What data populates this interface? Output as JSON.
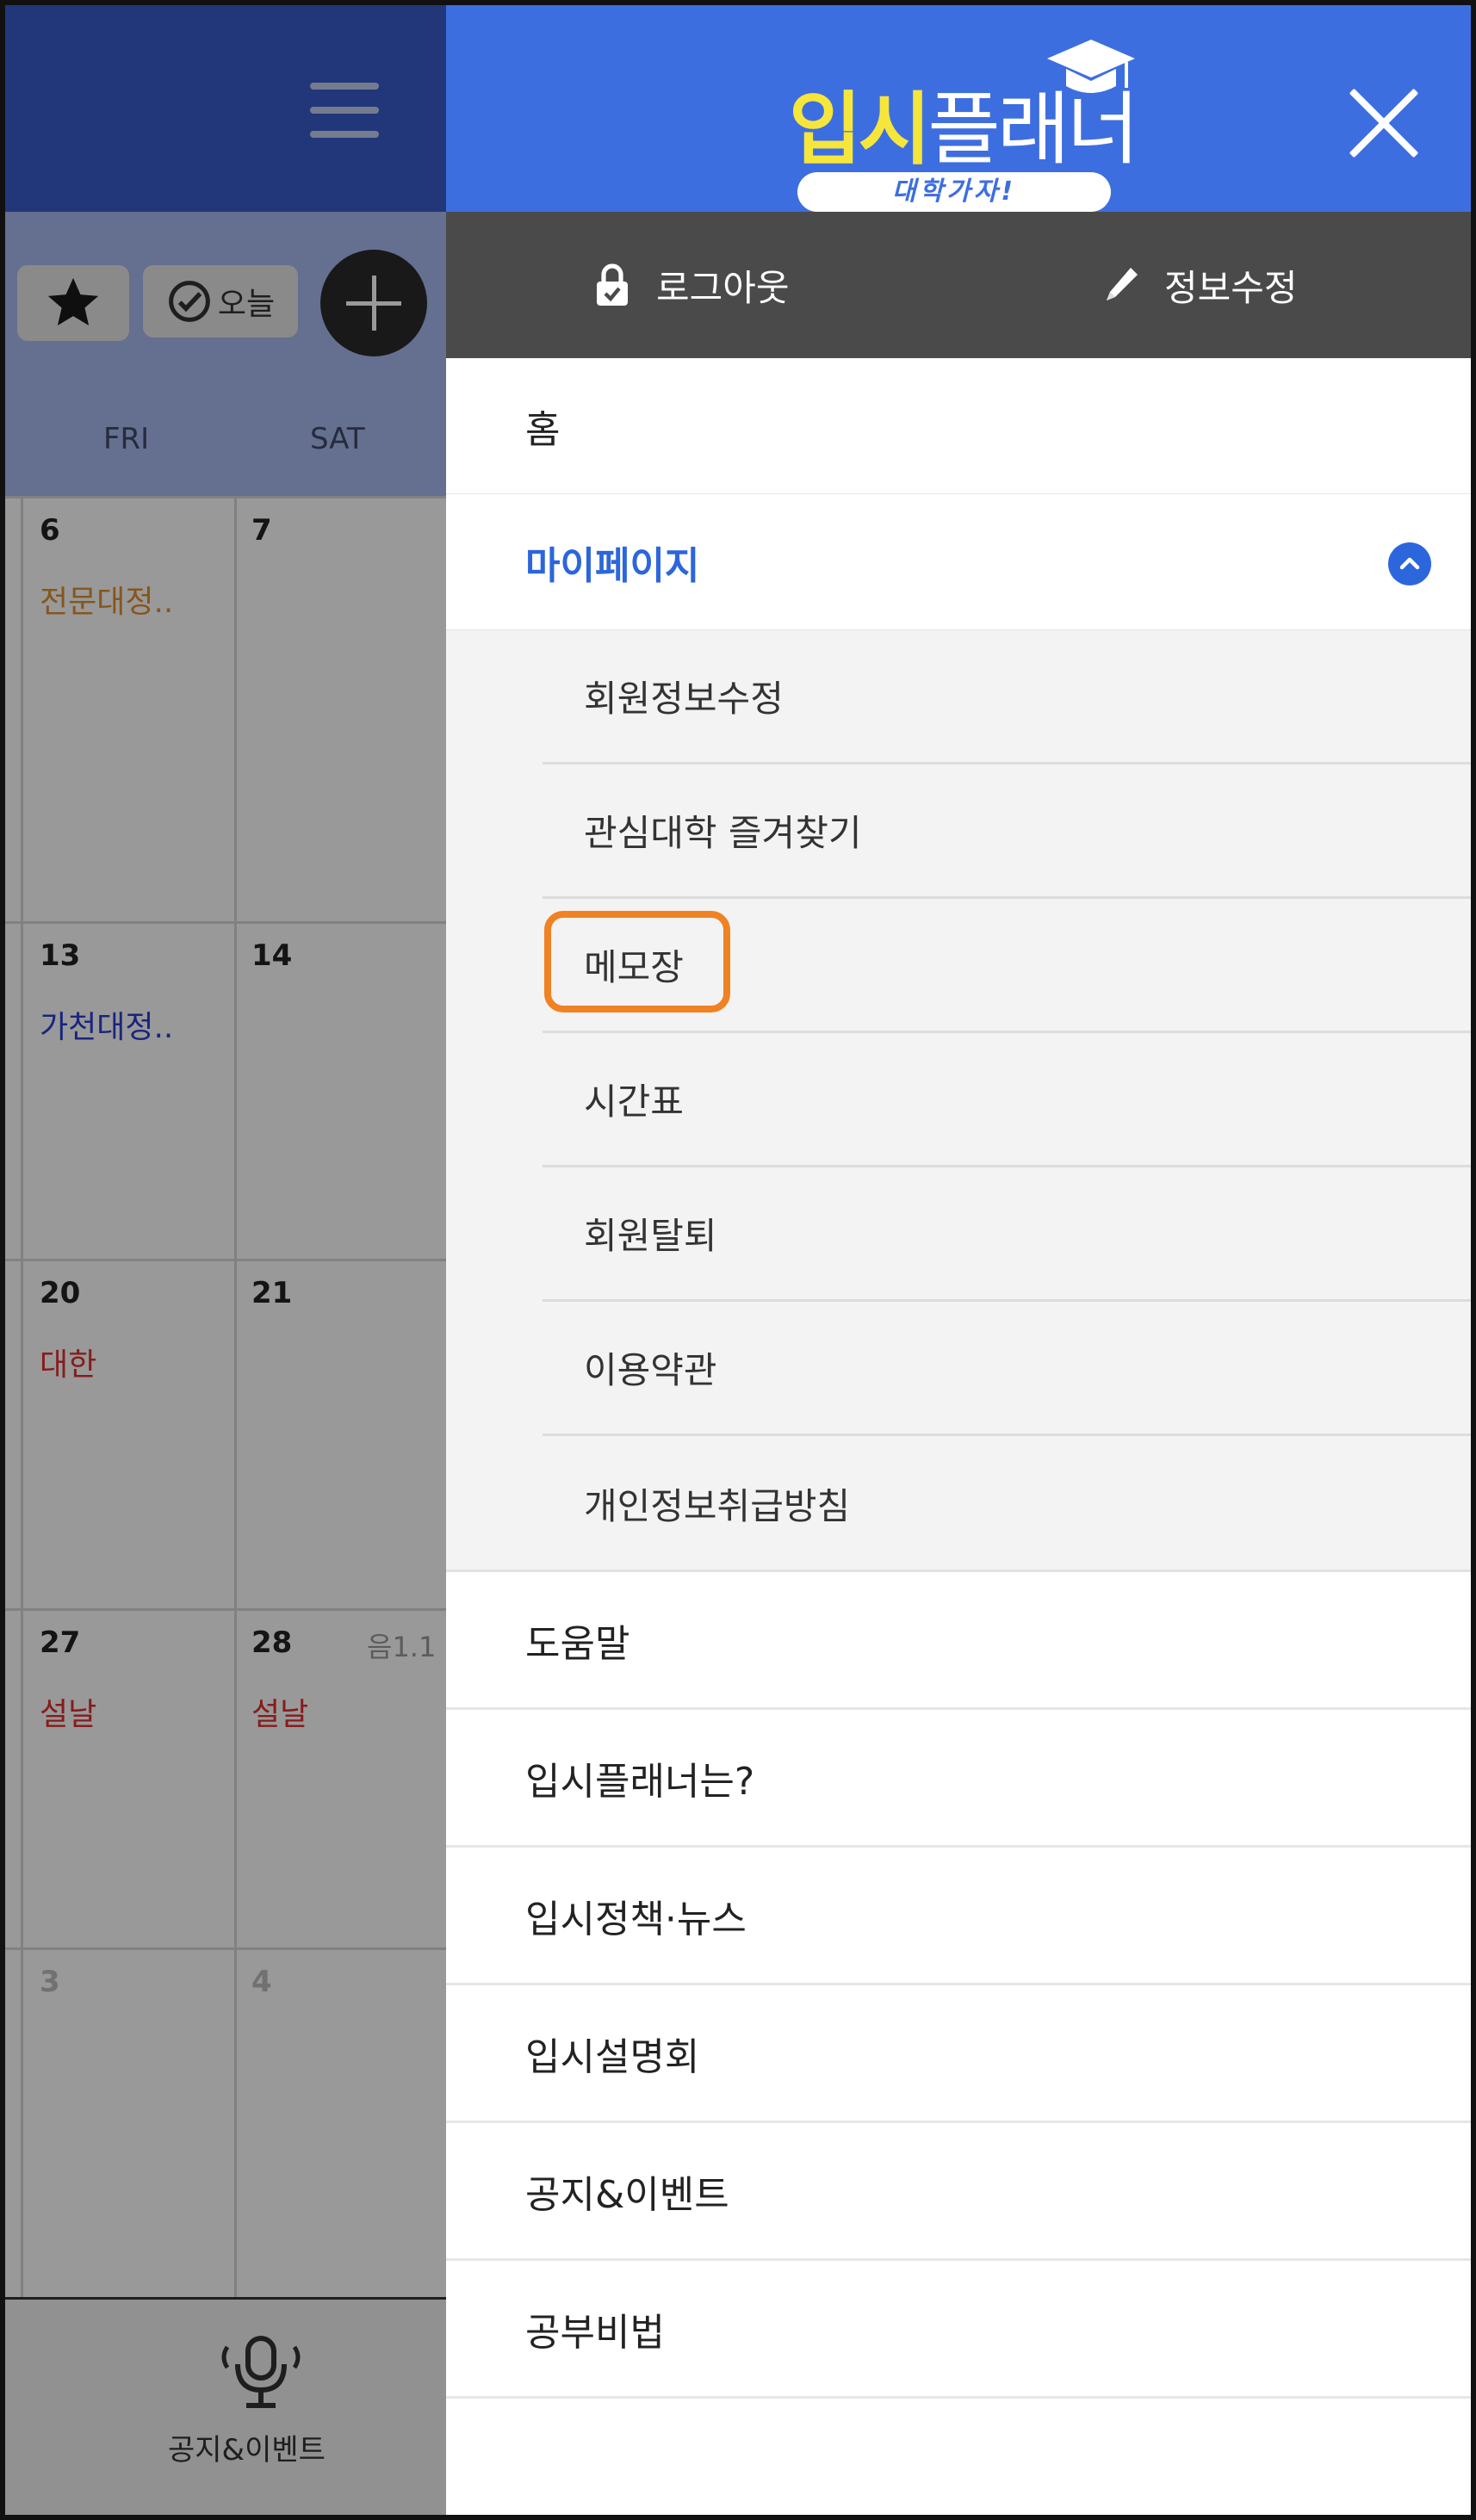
{
  "calendar": {
    "today_label": "오늘",
    "weekdays": [
      "FRI",
      "SAT"
    ],
    "rows": [
      {
        "days": [
          "6",
          "7"
        ],
        "events": [
          {
            "text": "전문대정..",
            "color": "#e09030"
          }
        ]
      },
      {
        "days": [
          "13",
          "14"
        ],
        "events": [
          {
            "text": "가천대정..",
            "color": "#2a3fd0"
          }
        ]
      },
      {
        "days": [
          "20",
          "21"
        ],
        "events": [
          {
            "text": "대한",
            "color": "#e03030"
          }
        ]
      },
      {
        "days": [
          "27",
          "28"
        ],
        "lunar": "음1.1",
        "events": [
          {
            "text": "설날",
            "color": "#e03030"
          },
          {
            "text": "설날",
            "color": "#e03030"
          }
        ]
      },
      {
        "days": [
          "3",
          "4"
        ],
        "events": []
      }
    ],
    "footer_label": "공지&이벤트"
  },
  "drawer": {
    "logo": {
      "text_yellow": "입시",
      "text_white": "플래너",
      "tagline": "대학가자!"
    },
    "logout_label": "로그아웃",
    "edit_info_label": "정보수정",
    "menu_top": [
      {
        "label": "홈"
      },
      {
        "label": "마이페이지",
        "expanded": true
      }
    ],
    "submenu": [
      {
        "label": "회원정보수정"
      },
      {
        "label": "관심대학 즐겨찾기"
      },
      {
        "label": "메모장",
        "highlighted": true
      },
      {
        "label": "시간표"
      },
      {
        "label": "회원탈퇴"
      },
      {
        "label": "이용약관"
      },
      {
        "label": "개인정보취급방침"
      }
    ],
    "menu_bottom": [
      {
        "label": "도움말"
      },
      {
        "label": "입시플래너는?"
      },
      {
        "label": "입시정책·뉴스"
      },
      {
        "label": "입시설명회"
      },
      {
        "label": "공지&이벤트"
      },
      {
        "label": "공부비법"
      }
    ]
  },
  "colors": {
    "header_blue": "#3d6ee0",
    "accent_blue": "#2c66dc",
    "highlight_orange": "#f08223",
    "bar_gray": "#4a4a4a"
  }
}
